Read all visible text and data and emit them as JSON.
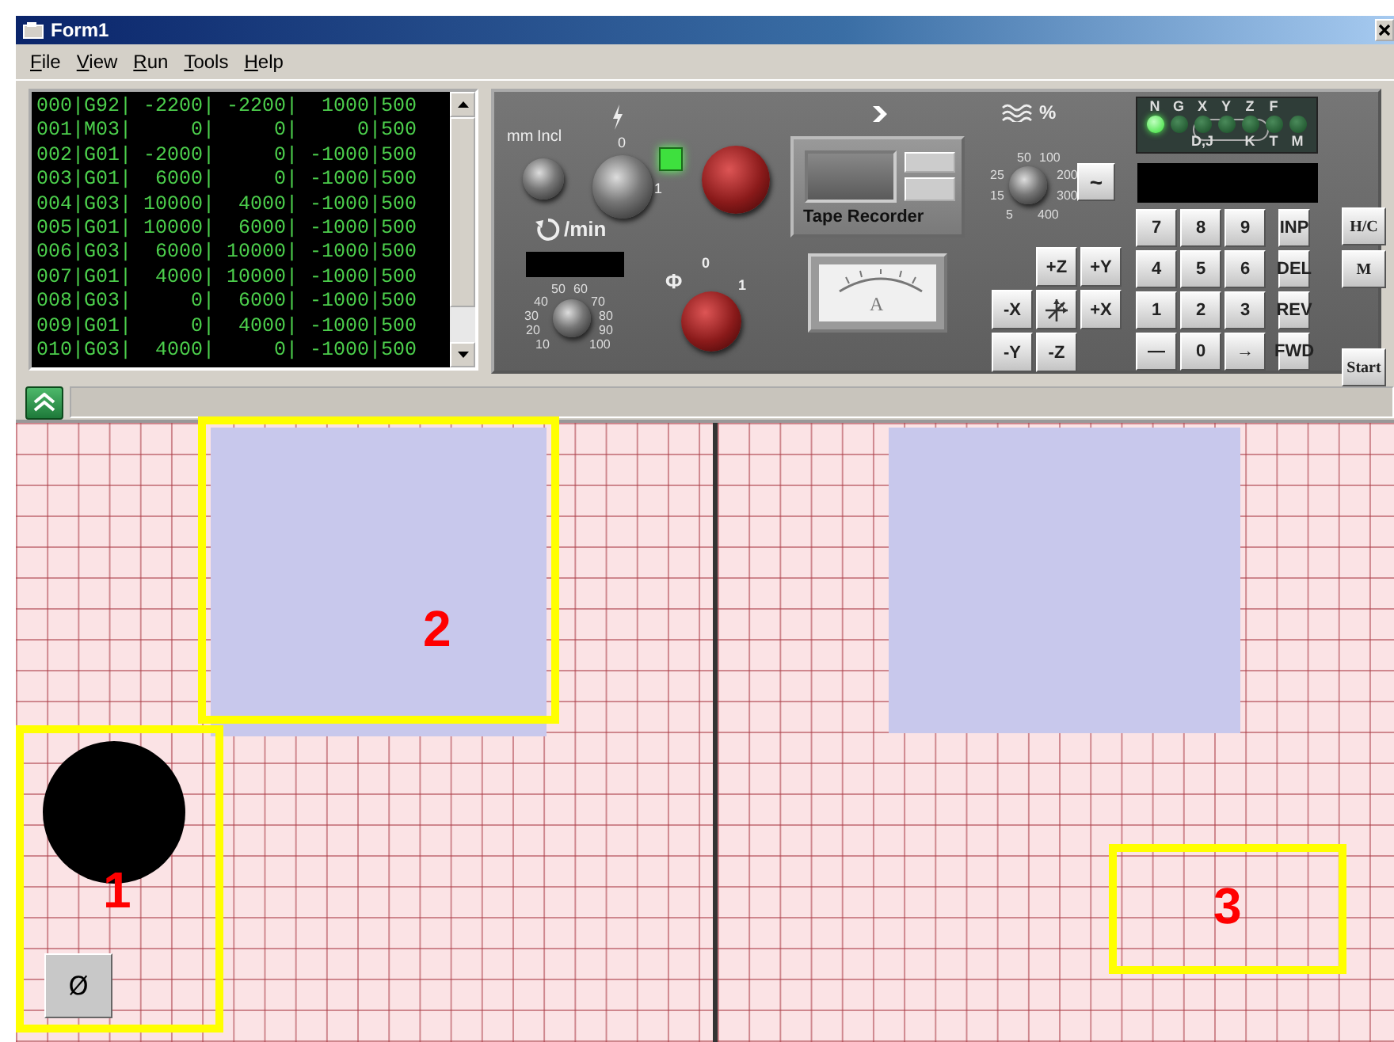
{
  "window": {
    "title": "Form1"
  },
  "menu": [
    {
      "label": "File"
    },
    {
      "label": "View"
    },
    {
      "label": "Run"
    },
    {
      "label": "Tools"
    },
    {
      "label": "Help"
    }
  ],
  "program_listing": {
    "lines": [
      "000|G92| -2200| -2200|  1000|500",
      "001|M03|     0|     0|     0|500",
      "002|G01| -2000|     0| -1000|500",
      "003|G01|  6000|     0| -1000|500",
      "004|G03| 10000|  4000| -1000|500",
      "005|G01| 10000|  6000| -1000|500",
      "006|G03|  6000| 10000| -1000|500",
      "007|G01|  4000| 10000| -1000|500",
      "008|G03|     0|  6000| -1000|500",
      "009|G01|     0|  4000| -1000|500",
      "010|G03|  4000|     0| -1000|500"
    ]
  },
  "panel": {
    "mode_labels": [
      "mm",
      "Incl"
    ],
    "power_switch": {
      "labels": [
        "0",
        "1"
      ]
    },
    "power_lamp": {
      "on": true
    },
    "spindle": {
      "unit": "/min",
      "speed_labels": [
        "50",
        "60",
        "40",
        "70",
        "30",
        "80",
        "20",
        "90",
        "10",
        "100"
      ]
    },
    "phase_switch": {
      "symbol": "Φ",
      "labels": [
        "0",
        "1"
      ]
    },
    "tape_recorder": {
      "label": "Tape Recorder"
    },
    "ammeter": {
      "unit": "A"
    },
    "feed_override": {
      "unit": "%",
      "labels": [
        "50",
        "100",
        "25",
        "200",
        "15",
        "300",
        "5",
        "400"
      ],
      "button": "~"
    },
    "indicators": [
      {
        "top": "N",
        "on": true
      },
      {
        "top": "G",
        "on": false
      },
      {
        "top": "X",
        "bottom": "D,J",
        "on": false
      },
      {
        "top": "Y",
        "on": false
      },
      {
        "top": "Z",
        "bottom": "K",
        "on": false
      },
      {
        "top": "F",
        "bottom": "T",
        "on": false
      },
      {
        "bottom": "M",
        "on": false
      }
    ],
    "jog_keys": [
      {
        "kind": "blank"
      },
      {
        "kind": "key",
        "label": "+Z"
      },
      {
        "kind": "key",
        "label": "+Y"
      },
      {
        "kind": "key",
        "label": "-X"
      },
      {
        "kind": "center"
      },
      {
        "kind": "key",
        "label": "+X"
      },
      {
        "kind": "key",
        "label": "-Y"
      },
      {
        "kind": "key",
        "label": "-Z"
      },
      {
        "kind": "blank"
      }
    ],
    "keypad": [
      [
        "7",
        "8",
        "9",
        "INP"
      ],
      [
        "4",
        "5",
        "6",
        "DEL"
      ],
      [
        "1",
        "2",
        "3",
        "REV"
      ],
      [
        "—",
        "0",
        "→",
        "FWD"
      ]
    ],
    "side_keys": [
      "H/C",
      "M",
      "Start"
    ]
  },
  "canvas": {
    "reset_button": "Ø"
  },
  "annotations": [
    {
      "number": "1"
    },
    {
      "number": "2"
    },
    {
      "number": "3"
    }
  ]
}
